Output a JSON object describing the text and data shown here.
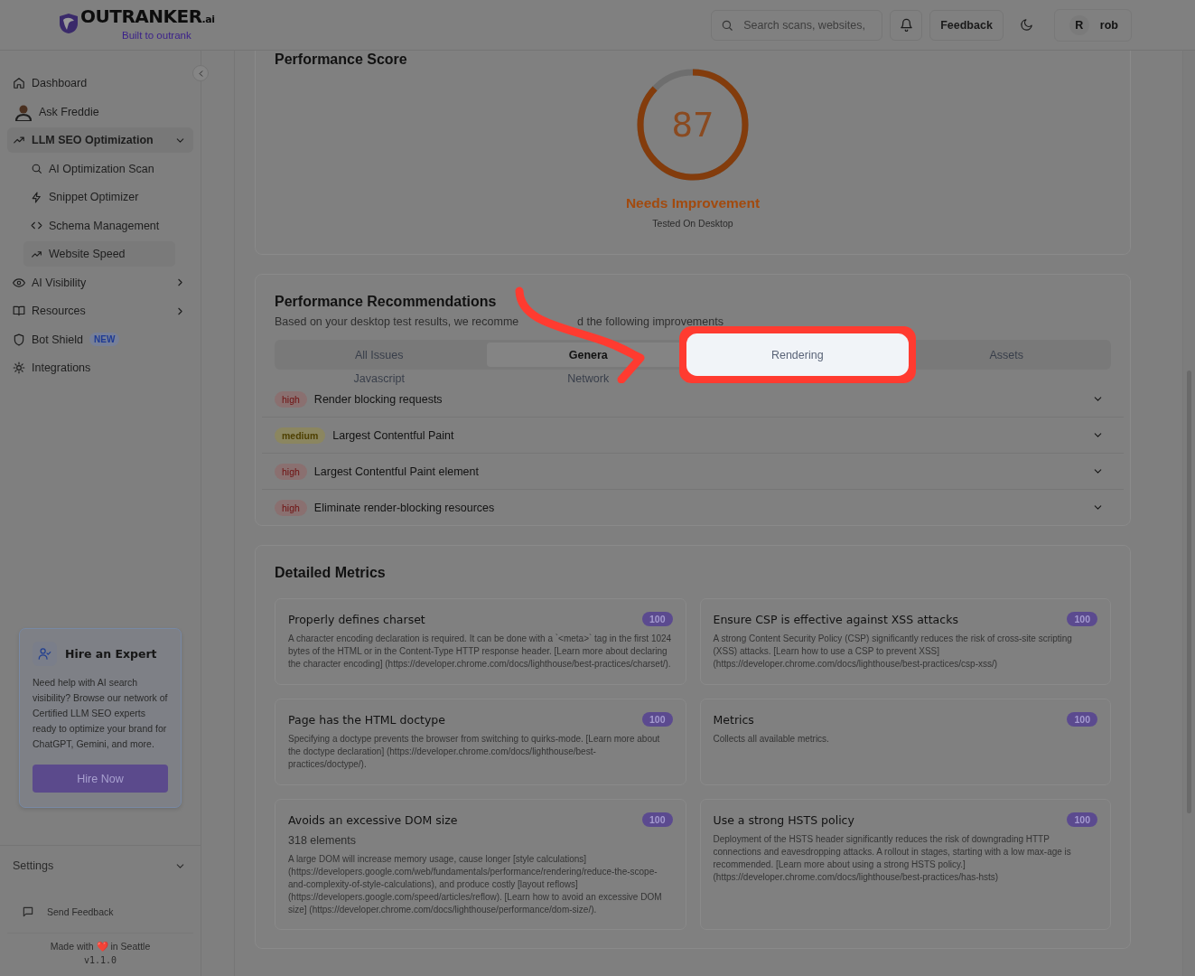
{
  "header": {
    "logo": {
      "name": "OUTRANKER",
      "suffix": ".ai",
      "tagline": "Built to outrank"
    },
    "search": {
      "placeholder": "Search scans, websites,"
    },
    "feedback_button": "Feedback",
    "user": {
      "initial": "R",
      "name": "rob"
    }
  },
  "sidebar": {
    "items": [
      {
        "label": "Dashboard",
        "kind": "link"
      },
      {
        "label": "Ask Freddie",
        "kind": "avatar"
      },
      {
        "label": "LLM SEO Optimization",
        "kind": "group",
        "expanded": true,
        "children": [
          {
            "label": "AI Optimization Scan",
            "selected": false
          },
          {
            "label": "Snippet Optimizer",
            "selected": false
          },
          {
            "label": "Schema Management",
            "selected": false
          },
          {
            "label": "Website Speed",
            "selected": true
          }
        ]
      },
      {
        "label": "AI Visibility",
        "kind": "group",
        "expanded": false
      },
      {
        "label": "Resources",
        "kind": "group",
        "expanded": false
      },
      {
        "label": "Bot Shield",
        "kind": "link",
        "badge": "NEW"
      },
      {
        "label": "Integrations",
        "kind": "link"
      }
    ],
    "hire": {
      "title": "Hire an Expert",
      "text": "Need help with AI search visibility? Browse our network of Certified LLM SEO experts ready to optimize your brand for ChatGPT, Gemini, and more.",
      "button": "Hire Now"
    },
    "settings": {
      "label": "Settings",
      "expanded": false
    },
    "feedback_link": "Send Feedback",
    "footer": {
      "credit": "Made with ❤️ in Seattle",
      "version": "v1.1.0"
    }
  },
  "score": {
    "title": "Performance Score",
    "value": "87",
    "level": 0.87,
    "rating": "Needs Improvement",
    "note": "Tested On Desktop"
  },
  "recommendations": {
    "title": "Performance Recommendations",
    "subtitle": [
      "Based on your desktop test results, we recomme",
      "d the following improvements"
    ],
    "tabs": [
      {
        "label": "All Issues",
        "selected": false,
        "highlighted": false
      },
      {
        "label": "Genera",
        "selected": true,
        "highlighted": false
      },
      {
        "label": "Rendering",
        "selected": false,
        "highlighted": true
      },
      {
        "label": "Assets",
        "selected": false,
        "highlighted": false
      },
      {
        "label": "Javascript",
        "selected": false,
        "highlighted": false
      },
      {
        "label": "Network",
        "selected": false,
        "highlighted": false
      }
    ],
    "issues": [
      {
        "severity": "high",
        "title": "Render blocking requests",
        "expanded": false
      },
      {
        "severity": "medium",
        "title": "Largest Contentful Paint",
        "expanded": false
      },
      {
        "severity": "high",
        "title": "Largest Contentful Paint element",
        "expanded": false
      },
      {
        "severity": "high",
        "title": "Eliminate render-blocking resources",
        "expanded": false
      }
    ]
  },
  "metrics": {
    "title": "Detailed Metrics",
    "items": [
      {
        "title": "Properly defines charset",
        "score": "100",
        "description": "A character encoding declaration is required. It can be done with a `<meta>` tag in the first 1024 bytes of the HTML or in the Content-Type HTTP response header. [Learn more about declaring the character encoding] (https://developer.chrome.com/docs/lighthouse/best-practices/charset/)."
      },
      {
        "title": "Ensure CSP is effective against XSS attacks",
        "score": "100",
        "description": "A strong Content Security Policy (CSP) significantly reduces the risk of cross-site scripting (XSS) attacks. [Learn how to use a CSP to prevent XSS] (https://developer.chrome.com/docs/lighthouse/best-practices/csp-xss/)"
      },
      {
        "title": "Page has the HTML doctype",
        "score": "100",
        "description": "Specifying a doctype prevents the browser from switching to quirks-mode. [Learn more about the doctype declaration] (https://developer.chrome.com/docs/lighthouse/best-practices/doctype/)."
      },
      {
        "title": "Metrics",
        "score": "100",
        "description": "Collects all available metrics."
      },
      {
        "title": "Avoids an excessive DOM size",
        "score": "100",
        "value": "318 elements",
        "description": "A large DOM will increase memory usage, cause longer [style calculations] (https://developers.google.com/web/fundamentals/performance/rendering/reduce-the-scope-and-complexity-of-style-calculations), and produce costly [layout reflows] (https://developers.google.com/speed/articles/reflow). [Learn how to avoid an excessive DOM size] (https://developer.chrome.com/docs/lighthouse/performance/dom-size/)."
      },
      {
        "title": "Use a strong HSTS policy",
        "score": "100",
        "description": "Deployment of the HSTS header significantly reduces the risk of downgrading HTTP connections and eavesdropping attacks. A rollout in stages, starting with a low max-age is recommended. [Learn more about using a strong HSTS policy.] (https://developer.chrome.com/docs/lighthouse/best-practices/has-hsts)"
      }
    ]
  }
}
